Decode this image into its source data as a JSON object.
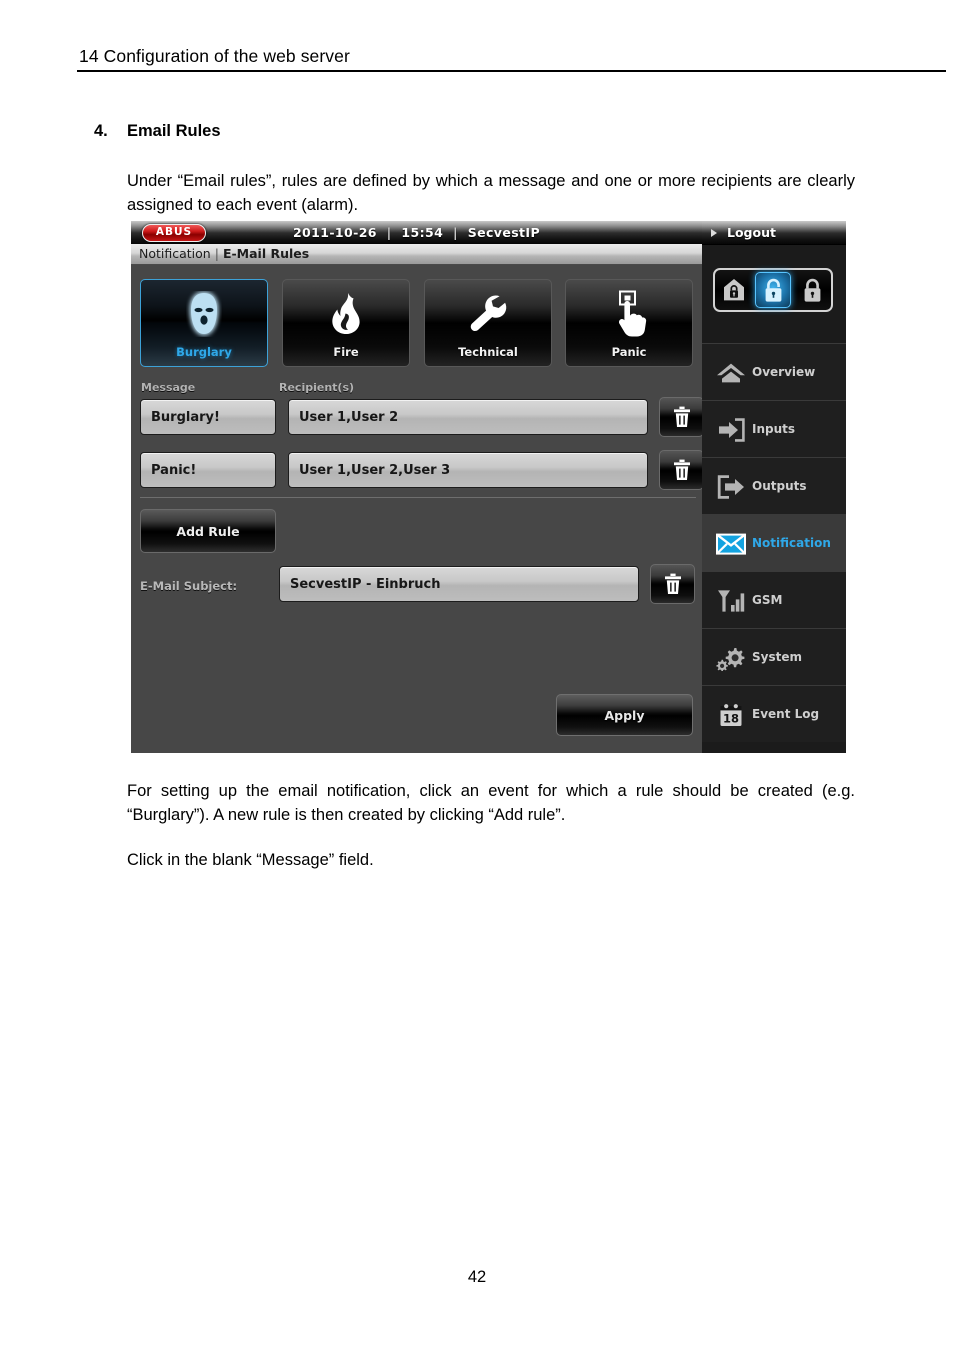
{
  "document": {
    "running_head": "14  Configuration of the web server",
    "section_number": "4.",
    "section_title": "Email Rules",
    "intro_paragraph": "Under “Email rules”, rules are defined by which a message and one or more recipients are clearly assigned to each event (alarm).",
    "after_paragraph": "For setting up the email notification, click an event for which a rule should be created (e.g. “Burglary”). A new rule is then created by clicking “Add rule”.",
    "click_paragraph": "Click in the blank “Message” field.",
    "page_number": "42"
  },
  "ui": {
    "topbar": {
      "logo": "ABUS",
      "date": "2011-10-26",
      "time": "15:54",
      "device": "SecvestIP",
      "separator": "|"
    },
    "breadcrumb": {
      "parent": "Notification",
      "divider": "|",
      "current": "E-Mail Rules"
    },
    "event_tabs": [
      {
        "label": "Burglary",
        "icon": "balaclava-icon",
        "selected": true
      },
      {
        "label": "Fire",
        "icon": "flame-icon",
        "selected": false
      },
      {
        "label": "Technical",
        "icon": "wrench-icon",
        "selected": false
      },
      {
        "label": "Panic",
        "icon": "hand-press-button-icon",
        "selected": false
      }
    ],
    "table": {
      "columns": {
        "message": "Message",
        "recipients": "Recipient(s)"
      },
      "rows": [
        {
          "message": "Burglary!",
          "recipients": "User 1,User 2"
        },
        {
          "message": "Panic!",
          "recipients": "User 1,User 2,User 3"
        }
      ],
      "delete_icon": "trash-icon"
    },
    "add_rule_label": "Add Rule",
    "subject": {
      "label": "E-Mail Subject:",
      "value": "SecvestIP - Einbruch"
    },
    "apply_label": "Apply",
    "sidebar": {
      "logout_label": "Logout",
      "arm_states": [
        {
          "name": "part-set-home-lock-icon",
          "active": false
        },
        {
          "name": "unset-open-lock-icon",
          "active": true
        },
        {
          "name": "set-closed-lock-icon",
          "active": false
        }
      ],
      "items": [
        {
          "label": "Overview",
          "icon": "home-icon",
          "active": false
        },
        {
          "label": "Inputs",
          "icon": "arrow-in-icon",
          "active": false
        },
        {
          "label": "Outputs",
          "icon": "arrow-out-icon",
          "active": false
        },
        {
          "label": "Notification",
          "icon": "envelope-icon",
          "active": true
        },
        {
          "label": "GSM",
          "icon": "signal-bars-icon",
          "active": false
        },
        {
          "label": "System",
          "icon": "gears-icon",
          "active": false
        },
        {
          "label": "Event Log",
          "icon": "calendar-18-icon",
          "active": false
        }
      ]
    },
    "colors": {
      "accent_blue": "#2fa8e8",
      "brand_red": "#d01b1b",
      "panel_bg": "#474747",
      "sidebar_bg": "#1f1f1f"
    }
  }
}
